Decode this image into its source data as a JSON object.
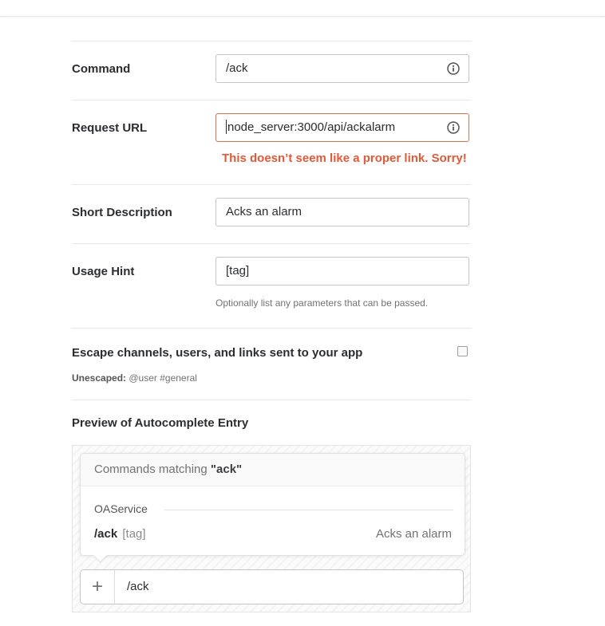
{
  "form": {
    "command": {
      "label": "Command",
      "value": "/ack"
    },
    "request_url": {
      "label": "Request URL",
      "value": "node_server:3000/api/ackalarm",
      "error": "This doesn’t seem like a proper link. Sorry!"
    },
    "short_description": {
      "label": "Short Description",
      "value": "Acks an alarm"
    },
    "usage_hint": {
      "label": "Usage Hint",
      "value": "[tag]",
      "help": "Optionally list any parameters that can be passed."
    },
    "escape": {
      "label": "Escape channels, users, and links sent to your app",
      "unescaped_label": "Unescaped:",
      "unescaped_example": "@user #general",
      "checked": false
    }
  },
  "preview": {
    "title": "Preview of Autocomplete Entry",
    "header_prefix": "Commands matching ",
    "header_query": "\"ack\"",
    "group_name": "OAService",
    "item": {
      "command": "/ack",
      "hint": "[tag]",
      "description": "Acks an alarm"
    },
    "message_input": {
      "value": "/ack",
      "plus": "+"
    }
  },
  "colors": {
    "error": "#e05a3a",
    "error_border": "#d8754f",
    "text": "#2c2d30",
    "muted": "#717274"
  },
  "icons": {
    "info": "info-circle-icon",
    "plus": "plus-icon"
  }
}
